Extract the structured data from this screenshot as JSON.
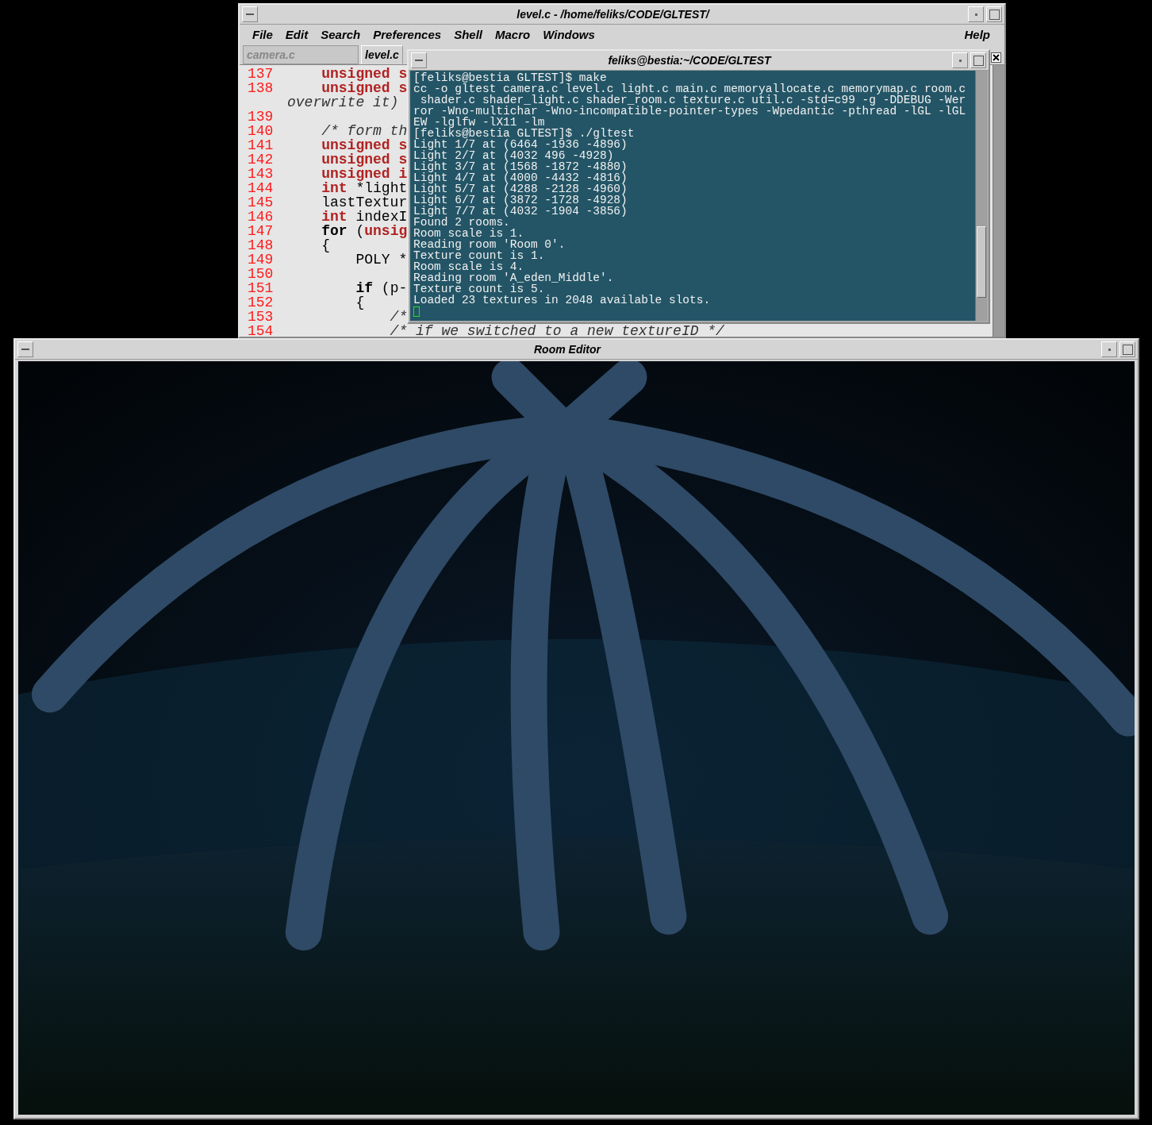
{
  "editor": {
    "title": "level.c - /home/feliks/CODE/GLTEST/",
    "menu": [
      {
        "label": "File"
      },
      {
        "label": "Edit"
      },
      {
        "label": "Search"
      },
      {
        "label": "Preferences"
      },
      {
        "label": "Shell"
      },
      {
        "label": "Macro"
      },
      {
        "label": "Windows"
      }
    ],
    "help": "Help",
    "tabs": [
      {
        "label": "camera.c",
        "selected": false
      },
      {
        "label": "level.c",
        "selected": true
      }
    ],
    "lines": [
      {
        "number": "137",
        "segments": [
          {
            "kind": "keyword",
            "text": "    unsigned s"
          }
        ]
      },
      {
        "number": "138",
        "segments": [
          {
            "kind": "keyword",
            "text": "    unsigned s"
          }
        ]
      },
      {
        "segments": [
          {
            "kind": "comment",
            "text": "overwrite it)"
          }
        ]
      },
      {
        "number": "139"
      },
      {
        "number": "140",
        "segments": [
          {
            "kind": "comment",
            "text": "    /* form th"
          }
        ]
      },
      {
        "number": "141",
        "segments": [
          {
            "kind": "keyword",
            "text": "    unsigned s"
          }
        ]
      },
      {
        "number": "142",
        "segments": [
          {
            "kind": "keyword",
            "text": "    unsigned s"
          }
        ]
      },
      {
        "number": "143",
        "segments": [
          {
            "kind": "keyword",
            "text": "    unsigned i"
          }
        ]
      },
      {
        "number": "144",
        "segments": [
          {
            "kind": "keyword",
            "text": "    int"
          },
          {
            "kind": "plain",
            "text": " *light"
          }
        ]
      },
      {
        "number": "145",
        "segments": [
          {
            "kind": "plain",
            "text": "    lastTextur"
          }
        ]
      },
      {
        "number": "146",
        "segments": [
          {
            "kind": "keyword",
            "text": "    int"
          },
          {
            "kind": "plain",
            "text": " indexI"
          }
        ]
      },
      {
        "number": "147",
        "segments": [
          {
            "kind": "control",
            "text": "    for"
          },
          {
            "kind": "plain",
            "text": " ("
          },
          {
            "kind": "keyword",
            "text": "unsig"
          }
        ]
      },
      {
        "number": "148",
        "segments": [
          {
            "kind": "plain",
            "text": "    {"
          }
        ]
      },
      {
        "number": "149",
        "segments": [
          {
            "kind": "plain",
            "text": "        POLY *"
          }
        ]
      },
      {
        "number": "150"
      },
      {
        "number": "151",
        "segments": [
          {
            "kind": "control",
            "text": "        if"
          },
          {
            "kind": "plain",
            "text": " (p-"
          }
        ]
      },
      {
        "number": "152",
        "segments": [
          {
            "kind": "plain",
            "text": "        {"
          }
        ]
      },
      {
        "number": "153",
        "segments": [
          {
            "kind": "comment",
            "text": "            /*"
          }
        ]
      },
      {
        "number": "154",
        "segments": [
          {
            "kind": "comment",
            "text": "            /* if we switched to a new textureID */"
          }
        ]
      }
    ]
  },
  "terminal": {
    "title": "feliks@bestia:~/CODE/GLTEST",
    "lines": [
      "[feliks@bestia GLTEST]$ make",
      "cc -o gltest camera.c level.c light.c main.c memoryallocate.c memorymap.c room.c",
      " shader.c shader_light.c shader_room.c texture.c util.c -std=c99 -g -DDEBUG -Wer",
      "ror -Wno-multichar -Wno-incompatible-pointer-types -Wpedantic -pthread -lGL -lGL",
      "EW -lglfw -lX11 -lm",
      "[feliks@bestia GLTEST]$ ./gltest",
      "Light 1/7 at (6464 -1936 -4896)",
      "Light 2/7 at (4032 496 -4928)",
      "Light 3/7 at (1568 -1872 -4880)",
      "Light 4/7 at (4000 -4432 -4816)",
      "Light 5/7 at (4288 -2128 -4960)",
      "Light 6/7 at (3872 -1728 -4928)",
      "Light 7/7 at (4032 -1904 -3856)",
      "Found 2 rooms.",
      "Room scale is 1.",
      "Reading room 'Room 0'.",
      "Texture count is 1.",
      "Room scale is 4.",
      "Reading room 'A_eden_Middle'.",
      "Texture count is 5.",
      "Loaded 23 textures in 2048 available slots."
    ]
  },
  "viewer": {
    "title": "Room Editor"
  }
}
